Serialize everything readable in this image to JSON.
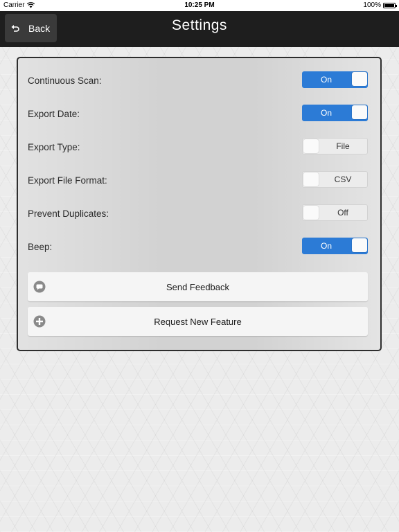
{
  "status_bar": {
    "carrier": "Carrier",
    "time": "10:25 PM",
    "battery": "100%"
  },
  "nav": {
    "back_label": "Back",
    "title": "Settings"
  },
  "settings": [
    {
      "label": "Continuous Scan:",
      "value": "On",
      "state": "on"
    },
    {
      "label": "Export Date:",
      "value": "On",
      "state": "on"
    },
    {
      "label": "Export Type:",
      "value": "File",
      "state": "off"
    },
    {
      "label": "Export File Format:",
      "value": "CSV",
      "state": "off"
    },
    {
      "label": "Prevent Duplicates:",
      "value": "Off",
      "state": "off"
    },
    {
      "label": "Beep:",
      "value": "On",
      "state": "on"
    }
  ],
  "actions": {
    "send_feedback": "Send Feedback",
    "request_feature": "Request New Feature"
  },
  "colors": {
    "toggle_on": "#2c7bd6",
    "navbar": "#1e1e1e"
  }
}
